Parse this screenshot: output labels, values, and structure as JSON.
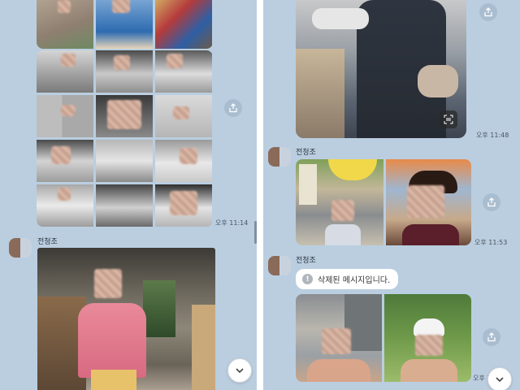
{
  "left_screen": {
    "photo_grid_time": "오후 11:14",
    "sender": "전청조"
  },
  "right_screen": {
    "photo1_time": "오후 11:48",
    "sender_1": "전청조",
    "photo2_time": "오후 11:53",
    "sender_2": "전청조",
    "deleted_message": "삭제된 메시지입니다.",
    "photo3_time": "오후 11:56"
  },
  "icons": {
    "share": "share-icon",
    "scroll_down": "chevron-down-icon",
    "scan": "scan-text-icon",
    "info": "info-icon"
  },
  "colors": {
    "chat_background": "#bacee0",
    "share_button": "#a9bdd0",
    "bubble": "#ffffff"
  }
}
